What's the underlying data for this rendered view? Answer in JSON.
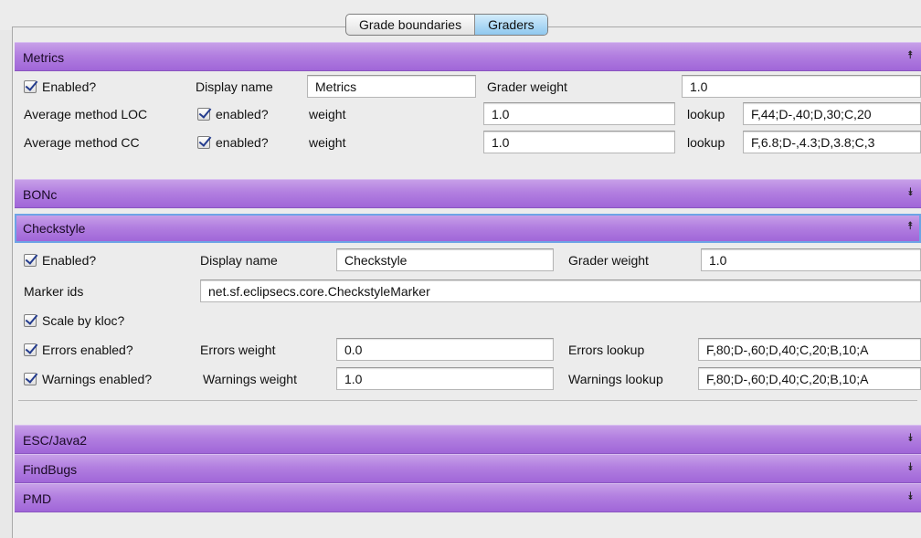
{
  "tabs": {
    "grade_boundaries": "Grade boundaries",
    "graders": "Graders"
  },
  "metrics": {
    "title": "Metrics",
    "enabled_label": "Enabled?",
    "display_name_label": "Display name",
    "display_name_value": "Metrics",
    "grader_weight_label": "Grader weight",
    "grader_weight_value": "1.0",
    "loc": {
      "label": "Average method LOC",
      "enabled_label": "enabled?",
      "weight_label": "weight",
      "weight_value": "1.0",
      "lookup_label": "lookup",
      "lookup_value": "F,44;D-,40;D,30;C,20"
    },
    "cc": {
      "label": "Average method CC",
      "enabled_label": "enabled?",
      "weight_label": "weight",
      "weight_value": "1.0",
      "lookup_label": "lookup",
      "lookup_value": "F,6.8;D-,4.3;D,3.8;C,3"
    }
  },
  "bonc": {
    "title": "BONc"
  },
  "checkstyle": {
    "title": "Checkstyle",
    "enabled_label": "Enabled?",
    "display_name_label": "Display name",
    "display_name_value": "Checkstyle",
    "grader_weight_label": "Grader weight",
    "grader_weight_value": "1.0",
    "marker_ids_label": "Marker ids",
    "marker_ids_value": "net.sf.eclipsecs.core.CheckstyleMarker",
    "scale_label": "Scale by kloc?",
    "errors": {
      "enabled_label": "Errors enabled?",
      "weight_label": "Errors weight",
      "weight_value": "0.0",
      "lookup_label": "Errors lookup",
      "lookup_value": "F,80;D-,60;D,40;C,20;B,10;A"
    },
    "warnings": {
      "enabled_label": "Warnings enabled?",
      "weight_label": "Warnings weight",
      "weight_value": "1.0",
      "lookup_label": "Warnings lookup",
      "lookup_value": "F,80;D-,60;D,40;C,20;B,10;A"
    }
  },
  "esc_java2": {
    "title": "ESC/Java2"
  },
  "findbugs": {
    "title": "FindBugs"
  },
  "pmd": {
    "title": "PMD"
  },
  "icons": {
    "expanded": "collapse-chevron-icon",
    "collapsed": "expand-chevron-icon"
  },
  "colors": {
    "header_purple": "#b27fe0",
    "active_tab_blue": "#8fc8ef",
    "checkmark": "#243c8e"
  }
}
